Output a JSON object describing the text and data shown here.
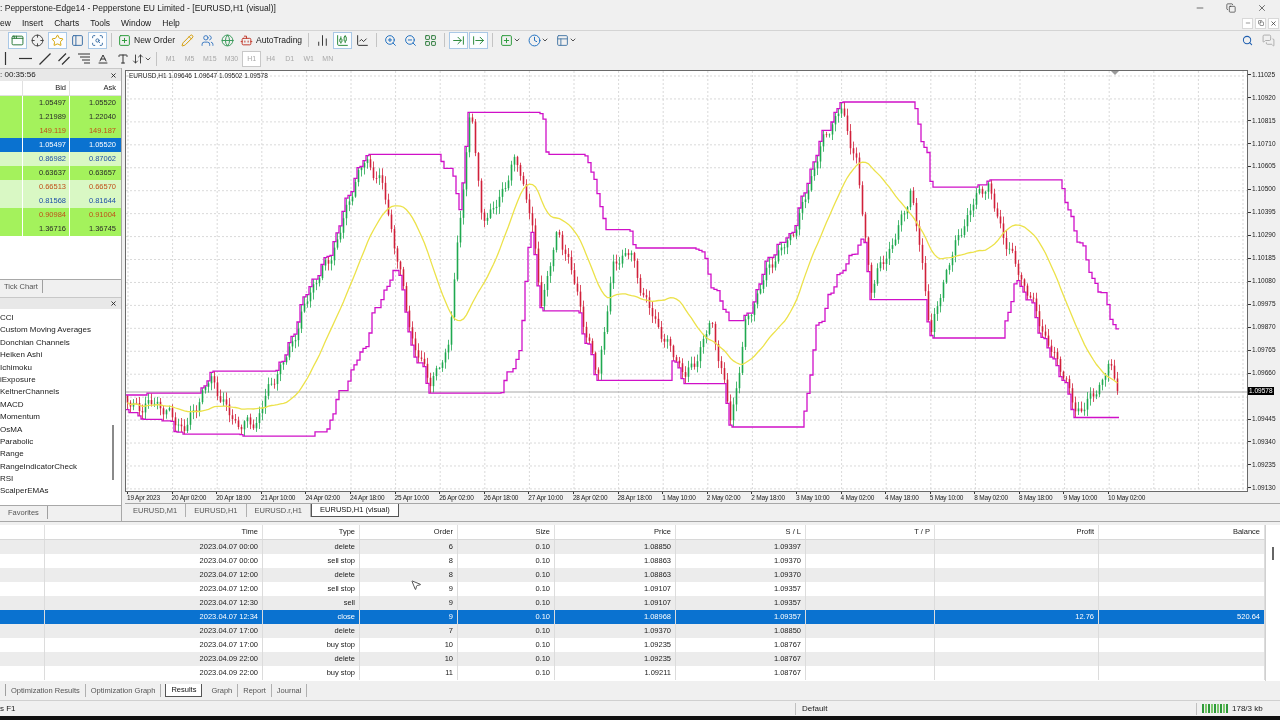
{
  "window": {
    "title": ": Pepperstone-Edge14 - Pepperstone EU Limited - [EURUSD,H1 (visual)]"
  },
  "menu": [
    "ew",
    "Insert",
    "Charts",
    "Tools",
    "Window",
    "Help"
  ],
  "toolbar": {
    "groups": [
      [
        {
          "kind": "window",
          "pressed": true
        },
        {
          "kind": "crosshair",
          "pressed": false
        },
        {
          "kind": "star",
          "pressed": true
        },
        {
          "kind": "panel",
          "pressed": false
        },
        {
          "kind": "magnifier",
          "pressed": true
        }
      ],
      [
        {
          "kind": "new_order",
          "label": "New Order"
        },
        {
          "kind": "pencil",
          "pressed": false
        },
        {
          "kind": "people",
          "pressed": false
        },
        {
          "kind": "globe",
          "pressed": false
        },
        {
          "kind": "auto_trading",
          "label": "AutoTrading"
        }
      ],
      [
        {
          "kind": "bars",
          "pressed": false
        },
        {
          "kind": "candles",
          "pressed": true
        },
        {
          "kind": "line",
          "pressed": false
        }
      ],
      [
        {
          "kind": "zoom_in",
          "pressed": false
        },
        {
          "kind": "zoom_out",
          "pressed": false
        },
        {
          "kind": "tile",
          "pressed": false
        }
      ],
      [
        {
          "kind": "shift",
          "pressed": true
        },
        {
          "kind": "autoscroll",
          "pressed": true
        }
      ],
      [
        {
          "kind": "indicators",
          "pressed": false
        },
        {
          "kind": "clock",
          "pressed": false
        },
        {
          "kind": "templates",
          "pressed": false
        }
      ]
    ]
  },
  "drawing_tools": [
    {
      "kind": "vertical_line"
    },
    {
      "kind": "horizontal_line"
    },
    {
      "kind": "trend_line"
    },
    {
      "kind": "channel"
    },
    {
      "kind": "fibonacci"
    },
    {
      "kind": "text"
    },
    {
      "kind": "label"
    },
    {
      "kind": "arrows"
    }
  ],
  "timeframes": [
    {
      "label": "M1",
      "selected": false,
      "disabled": true
    },
    {
      "label": "M5",
      "selected": false,
      "disabled": true
    },
    {
      "label": "M15",
      "selected": false,
      "disabled": true
    },
    {
      "label": "M30",
      "selected": false,
      "disabled": true
    },
    {
      "label": "H1",
      "selected": true,
      "disabled": true
    },
    {
      "label": "H4",
      "selected": false,
      "disabled": true
    },
    {
      "label": "D1",
      "selected": false,
      "disabled": true
    },
    {
      "label": "W1",
      "selected": false,
      "disabled": true
    },
    {
      "label": "MN",
      "selected": false,
      "disabled": true
    }
  ],
  "market_watch": {
    "title": ": 00:35:56",
    "columns": [
      "Bid",
      "Ask"
    ],
    "rows": [
      {
        "bid": "1.05497",
        "ask": "1.05520",
        "rising": false,
        "falling": false,
        "color": "#a4f25c",
        "selected": false
      },
      {
        "bid": "1.21989",
        "ask": "1.22040",
        "rising": false,
        "falling": false,
        "color": "#a4f25c",
        "selected": false
      },
      {
        "bid": "149.119",
        "ask": "149.187",
        "rising": false,
        "falling": true,
        "color": "#a4f25c",
        "selected": false
      },
      {
        "bid": "1.05497",
        "ask": "1.05520",
        "selected": true
      },
      {
        "bid": "0.86982",
        "ask": "0.87062",
        "rising": true,
        "falling": false,
        "color": "#d9f8c4",
        "selected": false
      },
      {
        "bid": "0.63637",
        "ask": "0.63657",
        "rising": false,
        "falling": false,
        "color": "#a4f25c",
        "selected": false
      },
      {
        "bid": "0.66513",
        "ask": "0.66570",
        "rising": false,
        "falling": true,
        "color": "#d9f8c4",
        "selected": false
      },
      {
        "bid": "0.81568",
        "ask": "0.81644",
        "rising": true,
        "falling": false,
        "color": "#d9f8c4",
        "selected": false
      },
      {
        "bid": "0.90984",
        "ask": "0.91004",
        "rising": false,
        "falling": true,
        "color": "#a4f25c",
        "selected": false
      },
      {
        "bid": "1.36716",
        "ask": "1.36745",
        "rising": false,
        "falling": false,
        "color": "#a4f25c",
        "selected": false
      }
    ],
    "tabs": [
      {
        "label": "Tick Chart",
        "selected": false
      }
    ]
  },
  "navigator": {
    "items": [
      "CCI",
      "Custom Moving Averages",
      "Donchian Channels",
      "Heiken Ashi",
      "Ichimoku",
      "iExposure",
      "KeltnerChannels",
      "MACD",
      "Momentum",
      "OsMA",
      "Parabolic",
      "Range",
      "RangeIndicatorCheck",
      "RSI",
      "ScalperEMAs"
    ],
    "tabs": [
      {
        "label": "Favorites",
        "selected": false
      }
    ]
  },
  "chart": {
    "info": "EURUSD,H1 1.09646 1.09647 1.09502 1.09578",
    "price_axis": [
      {
        "kind": "tick",
        "label": "1.11025"
      },
      {
        "kind": "tick",
        "label": "1.10920"
      },
      {
        "kind": "tick",
        "label": "1.10815"
      },
      {
        "kind": "tick",
        "label": "1.10710"
      },
      {
        "kind": "tick",
        "label": "1.10605"
      },
      {
        "kind": "tick",
        "label": "1.10500"
      },
      {
        "kind": "tick",
        "label": "1.10395"
      },
      {
        "kind": "tick",
        "label": "1.10290"
      },
      {
        "kind": "tick",
        "label": "1.10185"
      },
      {
        "kind": "tick",
        "label": "1.10080"
      },
      {
        "kind": "tick",
        "label": "1.09975"
      },
      {
        "kind": "tick",
        "label": "1.09870"
      },
      {
        "kind": "tick",
        "label": "1.09765"
      },
      {
        "kind": "tick",
        "label": "1.09660"
      },
      {
        "kind": "current",
        "label": "1.09578"
      },
      {
        "kind": "tick",
        "label": "1.09445"
      },
      {
        "kind": "tick",
        "label": "1.09340"
      },
      {
        "kind": "tick",
        "label": "1.09235"
      },
      {
        "kind": "tick",
        "label": "1.09130"
      }
    ],
    "time_axis": [
      "19 Apr 2023",
      "20 Apr 02:00",
      "20 Apr 18:00",
      "21 Apr 10:00",
      "24 Apr 02:00",
      "24 Apr 18:00",
      "25 Apr 10:00",
      "26 Apr 02:00",
      "26 Apr 18:00",
      "27 Apr 10:00",
      "28 Apr 02:00",
      "28 Apr 18:00",
      "1 May 10:00",
      "2 May 02:00",
      "2 May 18:00",
      "3 May 10:00",
      "4 May 02:00",
      "4 May 18:00",
      "5 May 10:00",
      "8 May 02:00",
      "8 May 18:00",
      "9 May 10:00",
      "10 May 02:00"
    ]
  },
  "chart_tabs": [
    {
      "label": "EURUSD,M1",
      "selected": false
    },
    {
      "label": "EURUSD,H1",
      "selected": false
    },
    {
      "label": "EURUSD.r,H1",
      "selected": false
    },
    {
      "label": "EURUSD,H1 (visual)",
      "selected": true
    }
  ],
  "tester": {
    "columns": [
      "Time",
      "Type",
      "Order",
      "Size",
      "Price",
      "S / L",
      "T / P",
      "Profit",
      "Balance"
    ],
    "rows": [
      {
        "time": "2023.04.07 00:00",
        "type": "delete",
        "order": "6",
        "size": "0.10",
        "price": "1.08850",
        "sl": "1.09397",
        "selected": false
      },
      {
        "time": "2023.04.07 00:00",
        "type": "sell stop",
        "order": "8",
        "size": "0.10",
        "price": "1.08863",
        "sl": "1.09370",
        "selected": false
      },
      {
        "time": "2023.04.07 12:00",
        "type": "delete",
        "order": "8",
        "size": "0.10",
        "price": "1.08863",
        "sl": "1.09370",
        "selected": false
      },
      {
        "time": "2023.04.07 12:00",
        "type": "sell stop",
        "order": "9",
        "size": "0.10",
        "price": "1.09107",
        "sl": "1.09357",
        "selected": false
      },
      {
        "time": "2023.04.07 12:30",
        "type": "sell",
        "order": "9",
        "size": "0.10",
        "price": "1.09107",
        "sl": "1.09357",
        "selected": false
      },
      {
        "time": "2023.04.07 12:34",
        "type": "close",
        "order": "9",
        "size": "0.10",
        "price": "1.08968",
        "sl": "1.09357",
        "profit": "12.76",
        "balance": "520.64",
        "selected": true
      },
      {
        "time": "2023.04.07 17:00",
        "type": "delete",
        "order": "7",
        "size": "0.10",
        "price": "1.09370",
        "sl": "1.08850",
        "selected": false
      },
      {
        "time": "2023.04.07 17:00",
        "type": "buy stop",
        "order": "10",
        "size": "0.10",
        "price": "1.09235",
        "sl": "1.08767",
        "selected": false
      },
      {
        "time": "2023.04.09 22:00",
        "type": "delete",
        "order": "10",
        "size": "0.10",
        "price": "1.09235",
        "sl": "1.08767",
        "selected": false
      },
      {
        "time": "2023.04.09 22:00",
        "type": "buy stop",
        "order": "11",
        "size": "0.10",
        "price": "1.09211",
        "sl": "1.08767",
        "selected": false
      }
    ],
    "tabs": [
      {
        "label": "Optimization Results",
        "selected": false
      },
      {
        "label": "Optimization Graph",
        "selected": false
      },
      {
        "label": "Results",
        "selected": true
      },
      {
        "label": "Graph",
        "selected": false
      },
      {
        "label": "Report",
        "selected": false
      },
      {
        "label": "Journal",
        "selected": false
      }
    ]
  },
  "status_bar": {
    "help": "s F1",
    "profile": "Default",
    "traffic": "178/3 kb"
  }
}
